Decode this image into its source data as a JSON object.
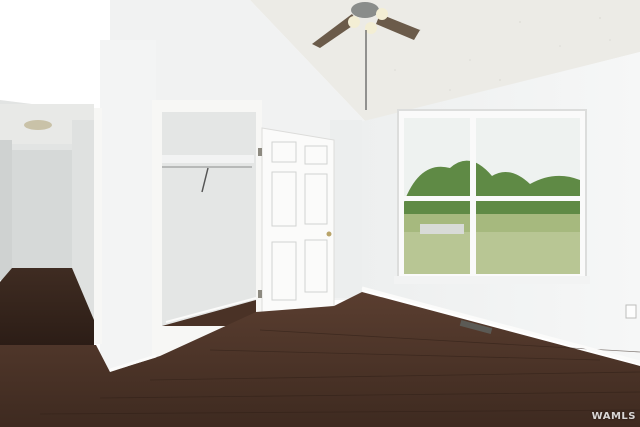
{
  "scene": {
    "description_tag": "empty-bedroom-listing-photo"
  },
  "watermark": {
    "text": "WAMLS"
  },
  "colors": {
    "wall_light": "#f4f5f5",
    "wall_shade": "#e6e8e8",
    "ceiling": "#ecebe6",
    "floor_base": "#4a3226",
    "floor_dark": "#33221a",
    "trim": "#f7f7f5",
    "sky": "#eef2f0",
    "trees": "#5f8a45",
    "grass": "#a6b97e",
    "fan_blade": "#6b5b4a"
  }
}
